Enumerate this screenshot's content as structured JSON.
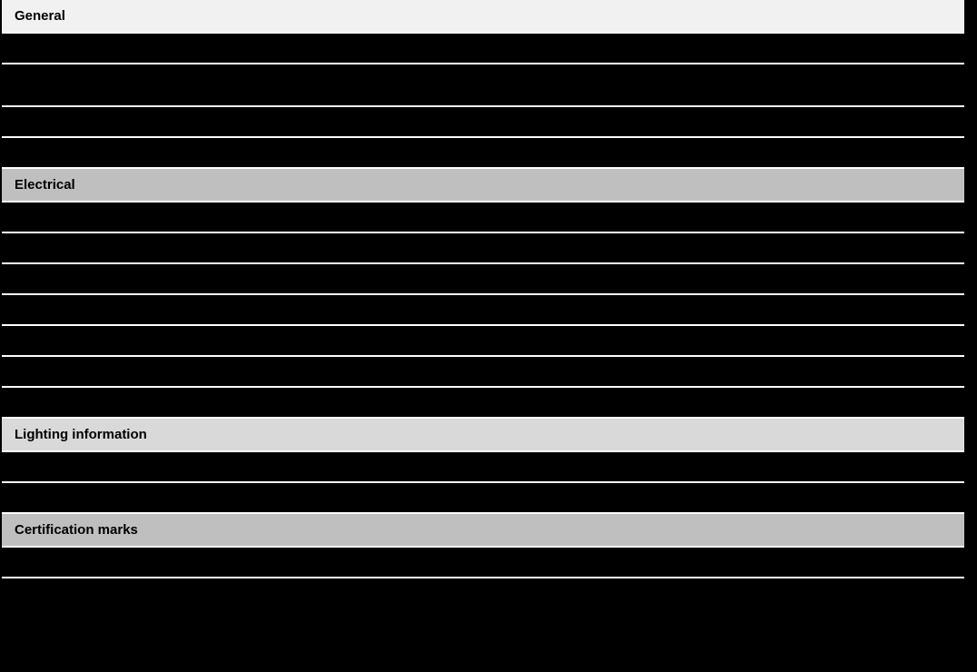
{
  "sections": [
    {
      "title": "General",
      "headerClass": "bg-light",
      "rows": [
        {
          "tall": false
        },
        {
          "tall": true
        },
        {
          "tall": false
        },
        {
          "tall": false
        }
      ]
    },
    {
      "title": "Electrical",
      "headerClass": "bg-med",
      "rows": [
        {
          "tall": false
        },
        {
          "tall": false
        },
        {
          "tall": false
        },
        {
          "tall": false
        },
        {
          "tall": false
        },
        {
          "tall": false
        },
        {
          "tall": false
        }
      ]
    },
    {
      "title": "Lighting information",
      "headerClass": "bg-soft",
      "rows": [
        {
          "tall": false
        },
        {
          "tall": false
        }
      ]
    },
    {
      "title": "Certification marks",
      "headerClass": "bg-med",
      "rows": [
        {
          "tall": false
        },
        {
          "tall": false
        }
      ]
    }
  ]
}
